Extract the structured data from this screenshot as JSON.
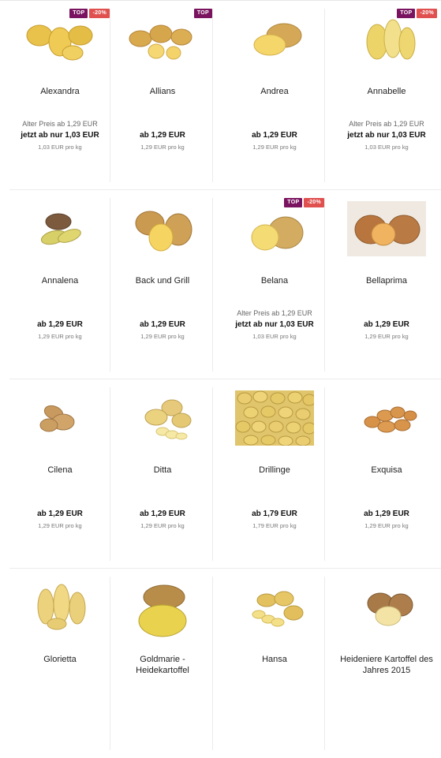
{
  "products": [
    {
      "name": "Alexandra",
      "badges": [
        "TOP",
        "-20%"
      ],
      "old_price": "Alter Preis ab 1,29 EUR",
      "price": "jetzt ab nur 1,03 EUR",
      "per_kg": "1,03 EUR pro kg",
      "image": "potato-group-icon"
    },
    {
      "name": "Allians",
      "badges": [
        "TOP"
      ],
      "old_price": "",
      "price": "ab 1,29 EUR",
      "per_kg": "1,29 EUR pro kg",
      "image": "potato-halves-icon"
    },
    {
      "name": "Andrea",
      "badges": [],
      "old_price": "",
      "price": "ab 1,29 EUR",
      "per_kg": "1,29 EUR pro kg",
      "image": "potato-cut-icon"
    },
    {
      "name": "Annabelle",
      "badges": [
        "TOP",
        "-20%"
      ],
      "old_price": "Alter Preis ab 1,29 EUR",
      "price": "jetzt ab nur 1,03 EUR",
      "per_kg": "1,03 EUR pro kg",
      "image": "potato-halves-icon"
    },
    {
      "name": "Annalena",
      "badges": [],
      "old_price": "",
      "price": "ab 1,29 EUR",
      "per_kg": "1,29 EUR pro kg",
      "image": "potato-dark-icon"
    },
    {
      "name": "Back und Grill",
      "badges": [],
      "old_price": "",
      "price": "ab 1,29 EUR",
      "per_kg": "1,29 EUR pro kg",
      "image": "potato-cut-icon"
    },
    {
      "name": "Belana",
      "badges": [
        "TOP",
        "-20%"
      ],
      "old_price": "Alter Preis ab 1,29 EUR",
      "price": "jetzt ab nur 1,03 EUR",
      "per_kg": "1,03 EUR pro kg",
      "image": "potato-cut-icon"
    },
    {
      "name": "Bellaprima",
      "badges": [],
      "old_price": "",
      "price": "ab 1,29 EUR",
      "per_kg": "1,29 EUR pro kg",
      "image": "potato-cut-icon"
    },
    {
      "name": "Cilena",
      "badges": [],
      "old_price": "",
      "price": "ab 1,29 EUR",
      "per_kg": "1,29 EUR pro kg",
      "image": "potato-group-icon"
    },
    {
      "name": "Ditta",
      "badges": [],
      "old_price": "",
      "price": "ab 1,29 EUR",
      "per_kg": "1,29 EUR pro kg",
      "image": "potato-slices-icon"
    },
    {
      "name": "Drillinge",
      "badges": [],
      "old_price": "",
      "price": "ab 1,79 EUR",
      "per_kg": "1,79 EUR pro kg",
      "image": "potato-pile-icon"
    },
    {
      "name": "Exquisa",
      "badges": [],
      "old_price": "",
      "price": "ab 1,29 EUR",
      "per_kg": "1,29 EUR pro kg",
      "image": "potato-group-icon"
    },
    {
      "name": "Glorietta",
      "badges": [],
      "old_price": "",
      "price": "",
      "per_kg": "",
      "image": "potato-group-icon"
    },
    {
      "name": "Goldmarie - Heidekartoffel",
      "badges": [],
      "old_price": "",
      "price": "",
      "per_kg": "",
      "image": "potato-cut-icon"
    },
    {
      "name": "Hansa",
      "badges": [],
      "old_price": "",
      "price": "",
      "per_kg": "",
      "image": "potato-slices-icon"
    },
    {
      "name": "Heideniere Kartoffel des Jahres 2015",
      "badges": [],
      "old_price": "",
      "price": "",
      "per_kg": "",
      "image": "potato-cut-icon"
    }
  ],
  "colors": {
    "badge_top": "#7a1460",
    "badge_discount": "#e0504f",
    "potato_skin": "#d9b25a",
    "potato_flesh": "#f2d86a"
  }
}
